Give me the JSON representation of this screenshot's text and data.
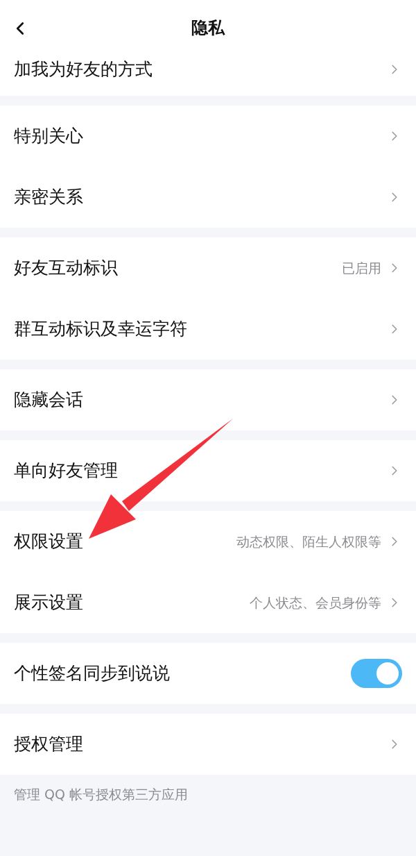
{
  "header": {
    "title": "隐私"
  },
  "groups": [
    {
      "items": [
        {
          "kind": "link",
          "label": "加我为好友的方式"
        }
      ]
    },
    {
      "items": [
        {
          "kind": "link",
          "label": "特别关心"
        },
        {
          "kind": "link",
          "label": "亲密关系"
        }
      ]
    },
    {
      "items": [
        {
          "kind": "link",
          "label": "好友互动标识",
          "value": "已启用"
        },
        {
          "kind": "link",
          "label": "群互动标识及幸运字符"
        }
      ]
    },
    {
      "items": [
        {
          "kind": "link",
          "label": "隐藏会话"
        }
      ]
    },
    {
      "items": [
        {
          "kind": "link",
          "label": "单向好友管理"
        }
      ]
    },
    {
      "items": [
        {
          "kind": "link",
          "label": "权限设置",
          "value": "动态权限、陌生人权限等"
        },
        {
          "kind": "link",
          "label": "展示设置",
          "value": "个人状态、会员身份等"
        }
      ]
    },
    {
      "items": [
        {
          "kind": "toggle",
          "label": "个性签名同步到说说",
          "on": true
        }
      ]
    },
    {
      "items": [
        {
          "kind": "link",
          "label": "授权管理"
        }
      ]
    }
  ],
  "footer_note": "管理 QQ 帐号授权第三方应用"
}
